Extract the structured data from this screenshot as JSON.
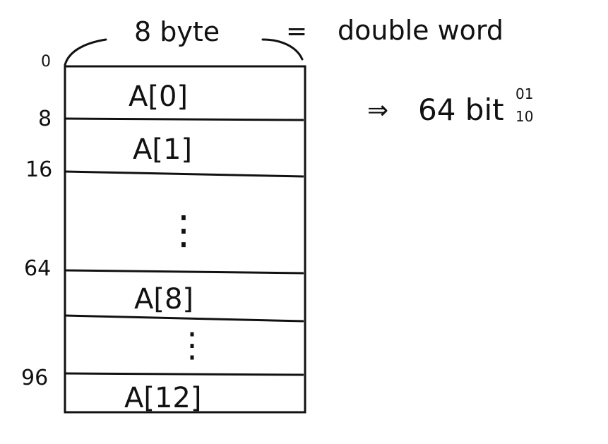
{
  "header": {
    "width_label": "8 byte",
    "equals_sign": "=",
    "word_label": "double word"
  },
  "note": {
    "arrow": "⇒",
    "bits_label": "64 bit",
    "binary_top": "01",
    "binary_bottom": "10"
  },
  "offsets": [
    "0",
    "8",
    "16",
    "64",
    "96"
  ],
  "cells": [
    {
      "label": "A[0]"
    },
    {
      "label": "A[1]"
    },
    {
      "label": "⋮"
    },
    {
      "label": "A[8]"
    },
    {
      "label": "⋮"
    },
    {
      "label": "A[12]"
    }
  ],
  "colors": {
    "ink": "#111111",
    "background": "#ffffff"
  }
}
